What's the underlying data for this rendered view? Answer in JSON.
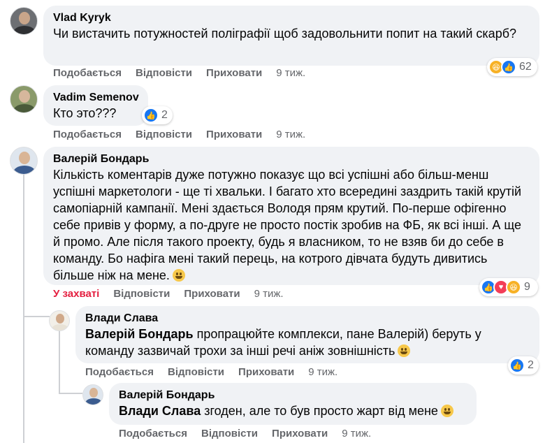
{
  "comments": [
    {
      "author": "Vlad Kyryk",
      "text": "Чи вистачить потужностей поліграфії щоб задовольнити попит на такий скарб?",
      "actions": {
        "like": "Подобається",
        "reply": "Відповісти",
        "hide": "Приховати",
        "time": "9 тиж."
      },
      "reactions": {
        "icons": [
          "haha-icon",
          "like-icon"
        ],
        "count": "62"
      }
    },
    {
      "author": "Vadim Semenov",
      "text": "Кто это???",
      "actions": {
        "like": "Подобається",
        "reply": "Відповісти",
        "hide": "Приховати",
        "time": "9 тиж."
      },
      "reactions": {
        "icons": [
          "like-icon"
        ],
        "count": "2"
      }
    },
    {
      "author": "Валерій Бондарь",
      "text": "Кількість коментарів дуже потужно показує що всі успішні або більш-менш успішні маркетологи - ще ті хвальки. І багато хто всередині заздрить такій крутій самопіарній кампанії. Мені здається Володя прям крутий. По-перше офігенно себе привів у форму, а по-друге не просто постік зробив на ФБ, як всі інші. А ще й промо. Але після такого проекту, будь я власником, то не взяв би до себе в команду. Бо нафіга мені такий перець, на котрого дівчата будуть дивитись більше ніж на мене.",
      "actions": {
        "like": "У захваті",
        "reply": "Відповісти",
        "hide": "Приховати",
        "time": "9 тиж."
      },
      "reactions": {
        "icons": [
          "like-icon",
          "love-icon",
          "haha-icon"
        ],
        "count": "9"
      }
    },
    {
      "author": "Влади Слава",
      "mention": "Валерій Бондарь",
      "text": " пропрацюйте комплекси, пане Валерій) беруть у команду зазвичай трохи за інші речі аніж зовнішність",
      "actions": {
        "like": "Подобається",
        "reply": "Відповісти",
        "hide": "Приховати",
        "time": "9 тиж."
      },
      "reactions": {
        "icons": [
          "like-icon"
        ],
        "count": "2"
      }
    },
    {
      "author": "Валерій Бондарь",
      "mention": "Влади Слава",
      "text": " згоден, але то був просто жарт від мене",
      "actions": {
        "like": "Подобається",
        "reply": "Відповісти",
        "hide": "Приховати",
        "time": "9 тиж."
      }
    }
  ],
  "colors": {
    "accent": "#1877f2",
    "liked": "#e41e3f",
    "bubble": "#f0f2f5",
    "meta": "#65676b"
  }
}
